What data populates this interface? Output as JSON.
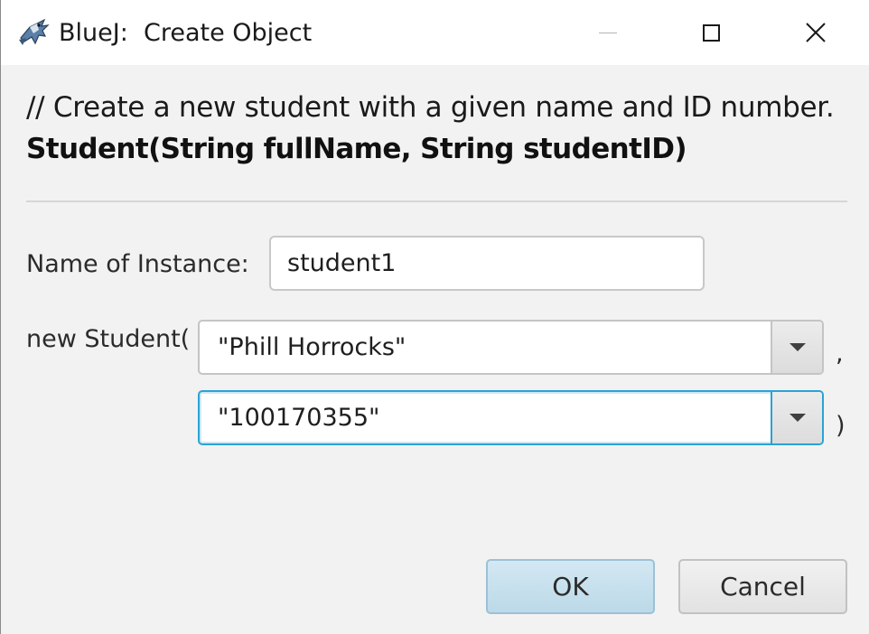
{
  "window": {
    "title": "BlueJ:  Create Object"
  },
  "header": {
    "comment": "// Create a new student with a given name and ID number.",
    "signature": "Student(String fullName, String studentID)"
  },
  "form": {
    "instance_label": "Name of Instance:",
    "instance_value": "student1",
    "constructor_label": "new Student(",
    "param_1_value": "\"Phill Horrocks\"",
    "param_separator": ",",
    "param_2_value": "\"100170355\"",
    "closing_paren": ")"
  },
  "buttons": {
    "ok_label": "OK",
    "cancel_label": "Cancel"
  },
  "colors": {
    "focus_accent": "#2aa3d4",
    "ok_button_bg": "#c8e0ee"
  }
}
